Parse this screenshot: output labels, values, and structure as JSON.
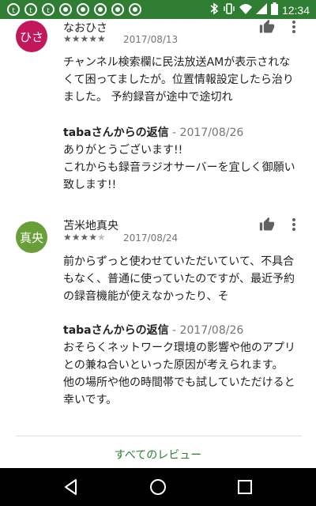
{
  "status_bar": {
    "time": "12:34",
    "colors": {
      "background": "#2e7d32"
    },
    "left_icons": [
      "tweetdeck-icon",
      "tweetdeck-icon",
      "tweetdeck-icon",
      "chrome-icon",
      "chrome-icon",
      "chrome-icon",
      "chrome-icon",
      "chrome-icon"
    ],
    "right_icons": [
      "bluetooth-icon",
      "vibrate-icon",
      "wifi-icon",
      "signal-icon",
      "battery-icon"
    ]
  },
  "reviews": [
    {
      "avatar_text": "ひさ",
      "avatar_color": "#c2185b",
      "author": "なおひさ",
      "stars": 5,
      "date": "2017/08/13",
      "text": "チャンネル検索欄に民法放送AMが表示されなくて困ってましたが。位置情報設定したら治りました。 予約録音が途中で途切れ",
      "reply_author": "tabaさんからの返信",
      "reply_date": " - 2017/08/26",
      "reply_text": "ありがとうございます!!\nこれからも録音ラジオサーバーを宜しく御願い致します!!"
    },
    {
      "avatar_text": "真央",
      "avatar_color": "#689f38",
      "author": "苫米地真央",
      "stars": 4,
      "date": "2017/08/24",
      "text": "前からずっと使わせていただいていて、不具合もなく、普通に使っていたのですが、最近予約の録音機能が使えなかったり、そ",
      "reply_author": "tabaさんからの返信",
      "reply_date": " - 2017/08/26",
      "reply_text": "おそらくネットワーク環境の影響や他のアプリとの兼ね合いといった原因が考えられます。\n他の場所や他の時間帯でも試していただけると幸いです。"
    }
  ],
  "all_reviews_label": "すべてのレビュー",
  "nav": {
    "icons": [
      "back-icon",
      "home-icon",
      "recents-icon"
    ]
  }
}
